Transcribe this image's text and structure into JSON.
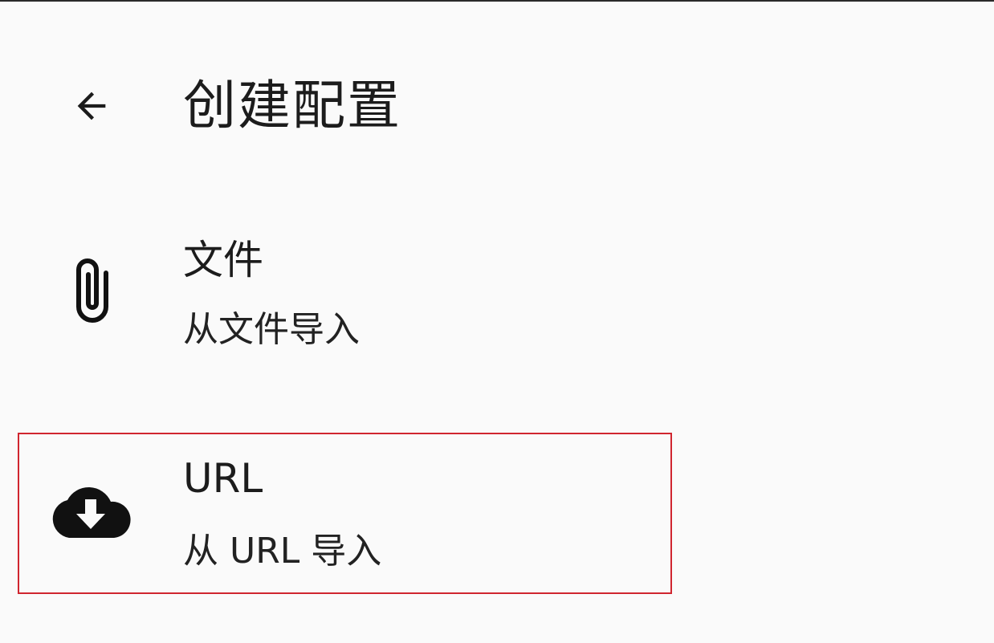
{
  "app_bar": {
    "back_icon": "arrow-left-icon",
    "title": "创建配置"
  },
  "items": [
    {
      "icon": "paperclip-icon",
      "title": "文件",
      "subtitle": "从文件导入"
    },
    {
      "icon": "cloud-download-icon",
      "title": "URL",
      "subtitle": "从 URL 导入"
    }
  ],
  "colors": {
    "background": "#fafafa",
    "text": "#1c1c1c",
    "highlight": "#d0262f"
  }
}
